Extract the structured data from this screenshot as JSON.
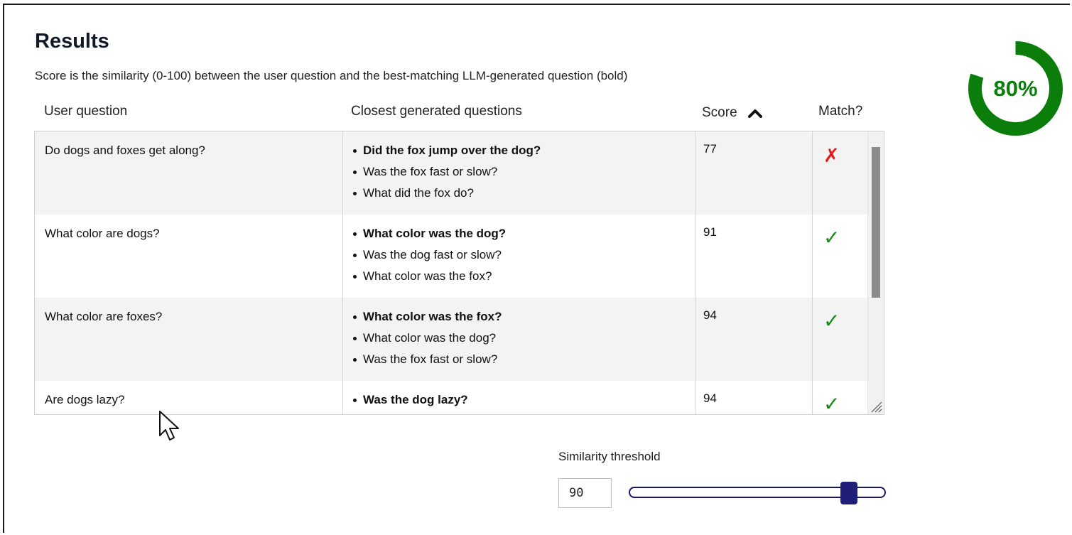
{
  "results": {
    "title": "Results",
    "subtitle": "Score is the similarity (0-100) between the user question and the best-matching LLM-generated question (bold)"
  },
  "table": {
    "headers": {
      "user_question": "User question",
      "closest": "Closest generated questions",
      "score": "Score",
      "match": "Match?"
    },
    "sort": {
      "column": "Score",
      "direction": "ascending",
      "icon": "chevron-up-icon"
    },
    "rows": [
      {
        "user_question": "Do dogs and foxes get along?",
        "generated": [
          "Did the fox jump over the dog?",
          "Was the fox fast or slow?",
          "What did the fox do?"
        ],
        "score": "77",
        "match": "✗",
        "match_icon": "cross-icon"
      },
      {
        "user_question": "What color are dogs?",
        "generated": [
          "What color was the dog?",
          "Was the dog fast or slow?",
          "What color was the fox?"
        ],
        "score": "91",
        "match": "✓",
        "match_icon": "check-icon"
      },
      {
        "user_question": "What color are foxes?",
        "generated": [
          "What color was the fox?",
          "What color was the dog?",
          "Was the fox fast or slow?"
        ],
        "score": "94",
        "match": "✓",
        "match_icon": "check-icon"
      },
      {
        "user_question": "Are dogs lazy?",
        "generated": [
          "Was the dog lazy?"
        ],
        "score": "94",
        "match": "✓",
        "match_icon": "check-icon"
      }
    ]
  },
  "summary": {
    "match_rate_label": "80%",
    "match_rate": 0.8,
    "color": "#0a7d0a"
  },
  "threshold": {
    "label": "Similarity threshold",
    "value": "90",
    "min": 0,
    "max": 100,
    "slider_value": 90
  },
  "colors": {
    "match_yes": "#168a16",
    "match_no": "#e51b1b",
    "slider": "#1f1f78"
  }
}
